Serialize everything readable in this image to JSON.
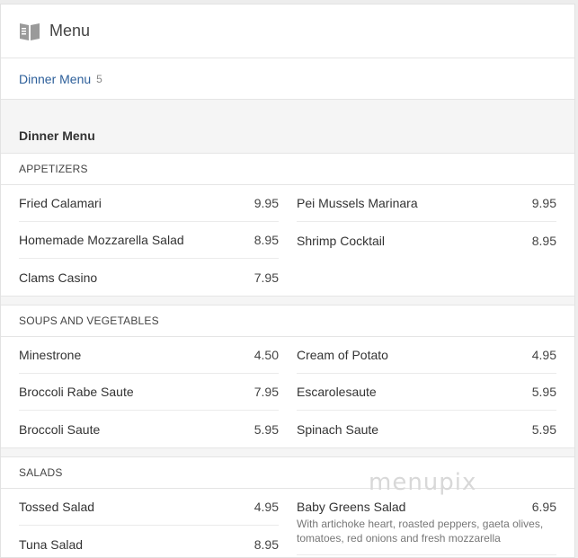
{
  "header": {
    "icon": "menu-book-icon",
    "title": "Menu"
  },
  "subnav": {
    "link_label": "Dinner Menu",
    "count": "5"
  },
  "menu": {
    "title": "Dinner Menu"
  },
  "sections": [
    {
      "title": "APPETIZERS",
      "left": [
        {
          "name": "Fried Calamari",
          "price": "9.95"
        },
        {
          "name": "Homemade Mozzarella Salad",
          "price": "8.95"
        },
        {
          "name": "Clams Casino",
          "price": "7.95"
        }
      ],
      "right": [
        {
          "name": "Pei Mussels Marinara",
          "price": "9.95"
        },
        {
          "name": "Shrimp Cocktail",
          "price": "8.95"
        }
      ]
    },
    {
      "title": "SOUPS AND VEGETABLES",
      "left": [
        {
          "name": "Minestrone",
          "price": "4.50"
        },
        {
          "name": "Broccoli Rabe Saute",
          "price": "7.95"
        },
        {
          "name": "Broccoli Saute",
          "price": "5.95"
        }
      ],
      "right": [
        {
          "name": "Cream of Potato",
          "price": "4.95"
        },
        {
          "name": "Escarolesaute",
          "price": "5.95"
        },
        {
          "name": "Spinach Saute",
          "price": "5.95"
        }
      ]
    },
    {
      "title": "SALADS",
      "left": [
        {
          "name": "Tossed Salad",
          "price": "4.95"
        },
        {
          "name": "Tuna Salad",
          "price": "8.95"
        }
      ],
      "right": [
        {
          "name": "Baby Greens Salad",
          "price": "6.95",
          "description": "With artichoke heart, roasted peppers, gaeta olives, tomatoes, red onions and fresh mozzarella"
        }
      ]
    }
  ],
  "watermark": "menupix"
}
